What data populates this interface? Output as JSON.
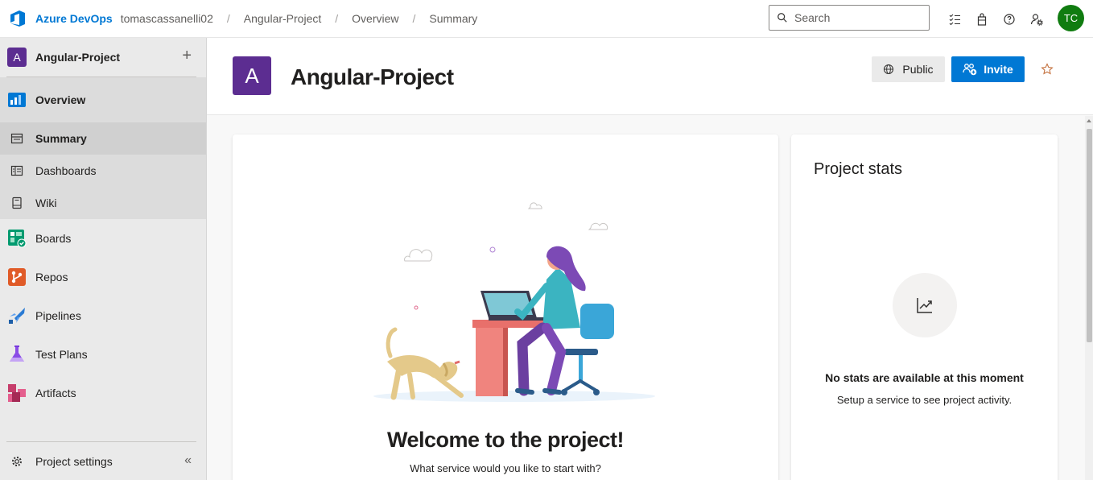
{
  "topbar": {
    "brand": "Azure DevOps",
    "breadcrumbs": [
      "tomascassanelli02",
      "Angular-Project",
      "Overview",
      "Summary"
    ],
    "search_placeholder": "Search",
    "icons": [
      "task-list-icon",
      "shopping-bag-icon",
      "help-icon",
      "user-settings-icon"
    ],
    "avatar_initials": "TC",
    "avatar_color": "#107c10",
    "brand_color": "#0078d4"
  },
  "sidebar": {
    "project_badge": "A",
    "project_name": "Angular-Project",
    "add_symbol": "+",
    "items": [
      {
        "label": "Overview",
        "icon": "overview-icon"
      },
      {
        "label": "Summary",
        "icon": "summary-icon"
      },
      {
        "label": "Dashboards",
        "icon": "dashboards-icon"
      },
      {
        "label": "Wiki",
        "icon": "wiki-icon"
      },
      {
        "label": "Boards",
        "icon": "boards-icon"
      },
      {
        "label": "Repos",
        "icon": "repos-icon"
      },
      {
        "label": "Pipelines",
        "icon": "pipelines-icon"
      },
      {
        "label": "Test Plans",
        "icon": "test-plans-icon"
      },
      {
        "label": "Artifacts",
        "icon": "artifacts-icon"
      }
    ],
    "settings_label": "Project settings",
    "collapse_symbol": "«",
    "active_item": "Summary"
  },
  "header": {
    "project_badge": "A",
    "title": "Angular-Project",
    "public_label": "Public",
    "invite_label": "Invite",
    "badge_color": "#5c2d91",
    "invite_color": "#0078d4"
  },
  "welcome": {
    "title": "Welcome to the project!",
    "subtitle": "What service would you like to start with?"
  },
  "stats": {
    "title": "Project stats",
    "empty_title": "No stats are available at this moment",
    "empty_subtitle": "Setup a service to see project activity."
  }
}
